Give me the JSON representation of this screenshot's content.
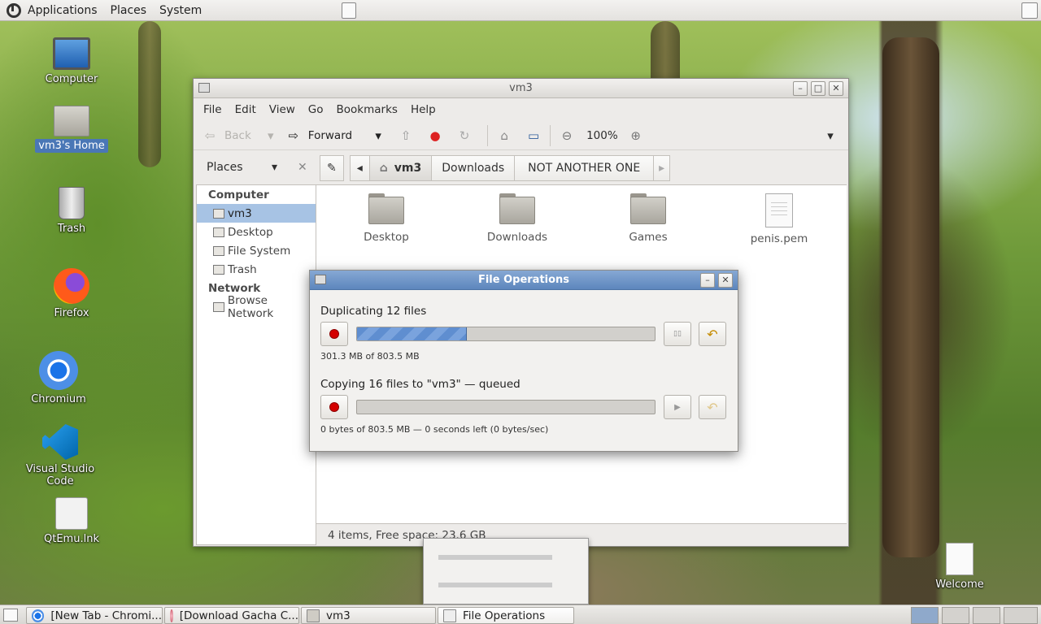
{
  "top_panel": {
    "menus": [
      "Applications",
      "Places",
      "System"
    ]
  },
  "desktop_icons": [
    {
      "label": "Computer"
    },
    {
      "label": "vm3's Home"
    },
    {
      "label": "Trash"
    },
    {
      "label": "Firefox"
    },
    {
      "label": "Chromium"
    },
    {
      "label": "Visual Studio Code"
    },
    {
      "label": "QtEmu.lnk"
    },
    {
      "label": "Welcome"
    }
  ],
  "file_manager": {
    "title": "vm3",
    "menus": [
      "File",
      "Edit",
      "View",
      "Go",
      "Bookmarks",
      "Help"
    ],
    "toolbar": {
      "back_label": "Back",
      "forward_label": "Forward",
      "zoom": "100%"
    },
    "sidebar": {
      "selector_label": "Places",
      "sections": [
        {
          "heading": "Computer",
          "items": [
            "vm3",
            "Desktop",
            "File System",
            "Trash"
          ]
        },
        {
          "heading": "Network",
          "items": [
            "Browse Network"
          ]
        }
      ],
      "selected": "vm3"
    },
    "breadcrumbs": [
      "vm3",
      "Downloads",
      "NOT ANOTHER ONE"
    ],
    "files": [
      {
        "name": "Desktop",
        "type": "folder"
      },
      {
        "name": "Downloads",
        "type": "folder"
      },
      {
        "name": "Games",
        "type": "folder"
      },
      {
        "name": "penis.pem",
        "type": "file"
      }
    ],
    "status": "4 items, Free space: 23.6 GB"
  },
  "file_operations": {
    "title": "File Operations",
    "operations": [
      {
        "label": "Duplicating 12 files",
        "progress": 0.37,
        "detail": "301.3 MB of 803.5 MB",
        "state": "running"
      },
      {
        "label": "Copying 16 files to \"vm3\" — queued",
        "progress": 0,
        "detail": "0 bytes of 803.5 MB — 0 seconds left (0 bytes/sec)",
        "state": "queued"
      }
    ]
  },
  "taskbar": {
    "tasks": [
      {
        "label": "[New Tab - Chromi..."
      },
      {
        "label": "[Download Gacha C..."
      },
      {
        "label": "vm3"
      },
      {
        "label": "File Operations"
      }
    ]
  }
}
